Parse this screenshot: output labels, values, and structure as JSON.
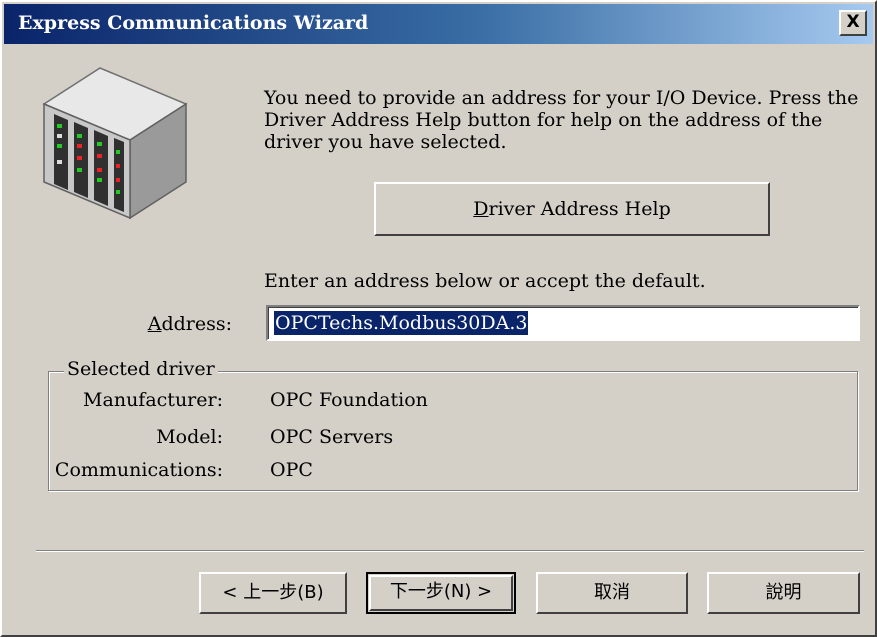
{
  "window": {
    "title": "Express Communications Wizard",
    "close_label": "X"
  },
  "icon": {
    "name": "server-rack-icon"
  },
  "intro": {
    "text": "You need to provide an address for your I/O Device. Press the Driver Address Help button for help on the address of the driver you have selected."
  },
  "driver_help_button": {
    "label_prefix": "D",
    "label_rest": "river Address Help"
  },
  "address": {
    "instruction": "Enter an address below or accept the default.",
    "label_prefix": "A",
    "label_rest": "ddress:",
    "value": "OPCTechs.Modbus30DA.3"
  },
  "selected_driver": {
    "legend": "Selected driver",
    "rows": [
      {
        "label": "Manufacturer:",
        "value": "OPC Foundation"
      },
      {
        "label": "Model:",
        "value": "OPC Servers"
      },
      {
        "label": "Communications:",
        "value": "OPC"
      }
    ]
  },
  "buttons": {
    "back": "< 上一步(B)",
    "next": "下一步(N) >",
    "cancel": "取消",
    "help": "說明"
  },
  "colors": {
    "titlebar_start": "#0a246a",
    "titlebar_end": "#a6caf0",
    "face": "#d4d0c8",
    "selection": "#0a246a"
  }
}
